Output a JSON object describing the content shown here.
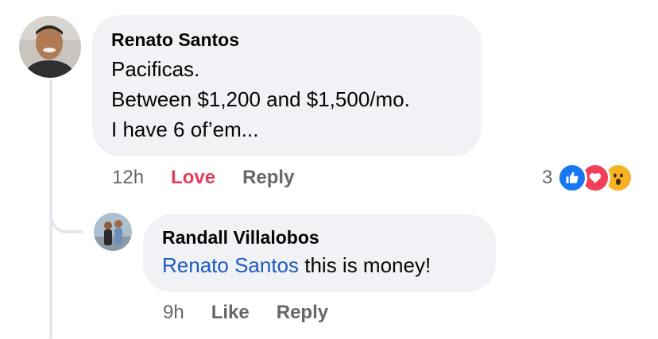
{
  "comment": {
    "author": "Renato Santos",
    "lines": [
      "Pacificas.",
      "Between $1,200 and $1,500/mo.",
      "I have 6 of’em..."
    ],
    "time": "12h",
    "love_label": "Love",
    "reply_label": "Reply",
    "reaction_count": "3",
    "reactions": [
      "like-icon",
      "love-icon",
      "wow-icon"
    ]
  },
  "reply": {
    "author": "Randall Villalobos",
    "mention": "Renato Santos",
    "text": " this is money!",
    "time": "9h",
    "like_label": "Like",
    "reply_label": "Reply"
  },
  "colors": {
    "bubble": "#f0f2f5",
    "love": "#e33f5c",
    "mention": "#1d5bbf",
    "meta": "#65676b",
    "like": "#1877f2",
    "wow": "#f7b125"
  }
}
